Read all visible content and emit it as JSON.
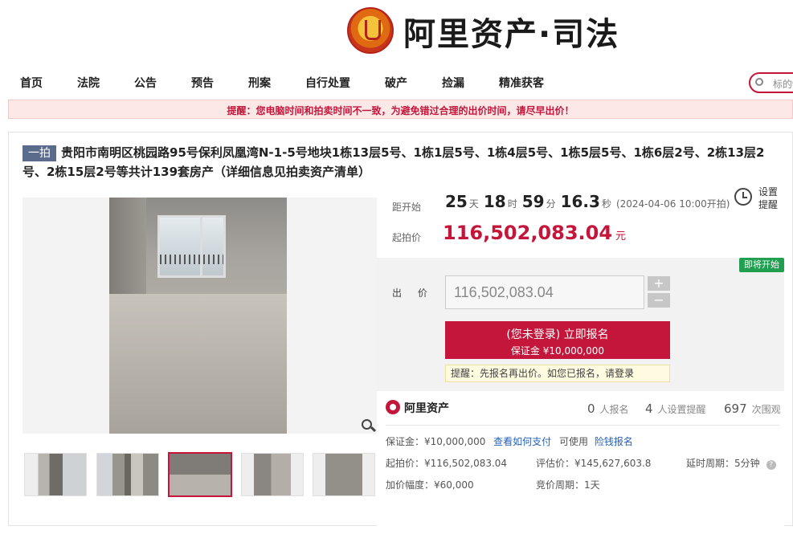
{
  "header": {
    "brand": "阿里资产·司法"
  },
  "nav": {
    "items": [
      "首页",
      "法院",
      "公告",
      "预告",
      "刑案",
      "自行处置",
      "破产",
      "捡漏",
      "精准获客"
    ],
    "search_placeholder": "标的物"
  },
  "warning": "提醒：您电脑时间和拍卖时间不一致，为避免错过合理的出价时间，请尽早出价！",
  "item": {
    "tag": "一拍",
    "title": "贵阳市南明区桃园路95号保利凤凰湾N-1-5号地块1栋13层5号、1栋1层5号、1栋4层5号、1栋5层5号、1栋6层2号、2栋13层2号、2栋15层2号等共计139套房产（详细信息见拍卖资产清单）"
  },
  "countdown": {
    "label": "距开始",
    "days": "25",
    "days_unit": "天",
    "hours": "18",
    "hours_unit": "时",
    "minutes": "59",
    "minutes_unit": "分",
    "seconds": "16.3",
    "seconds_unit": "秒",
    "note": "(2024-04-06 10:00开拍)"
  },
  "remind": {
    "label": "设置提醒"
  },
  "start": {
    "label": "起拍价",
    "price": "116,502,083.04",
    "unit": "元"
  },
  "bid": {
    "badge": "即将开始",
    "label": "出 价",
    "value": "116,502,083.04",
    "plus": "+",
    "minus": "−",
    "register_line1": "(您未登录) 立即报名",
    "register_line2": "保证金 ¥10,000,000",
    "tip_prefix": "提醒：先报名再出价。如您已报名，请",
    "tip_link": "登录"
  },
  "stats": {
    "brand": "阿里资产",
    "signup_count": "0",
    "signup_label": "人报名",
    "remind_count": "4",
    "remind_label": "人设置提醒",
    "views_count": "697",
    "views_label": "次围观"
  },
  "details": {
    "deposit": "保证金：¥10,000,000",
    "how_to_pay": "查看如何支付",
    "usable": "可使用",
    "insurance": "险钱报名",
    "start_price": "起拍价：¥116,502,083.04",
    "valuation": "评估价：¥145,627,603.8",
    "delay": "延时周期：5分钟",
    "increment": "加价幅度：¥60,000",
    "period": "竞价周期：1天"
  },
  "colors": {
    "brand_red": "#c4163a",
    "badge_green": "#1f9f4f",
    "link_blue": "#2461b8"
  }
}
